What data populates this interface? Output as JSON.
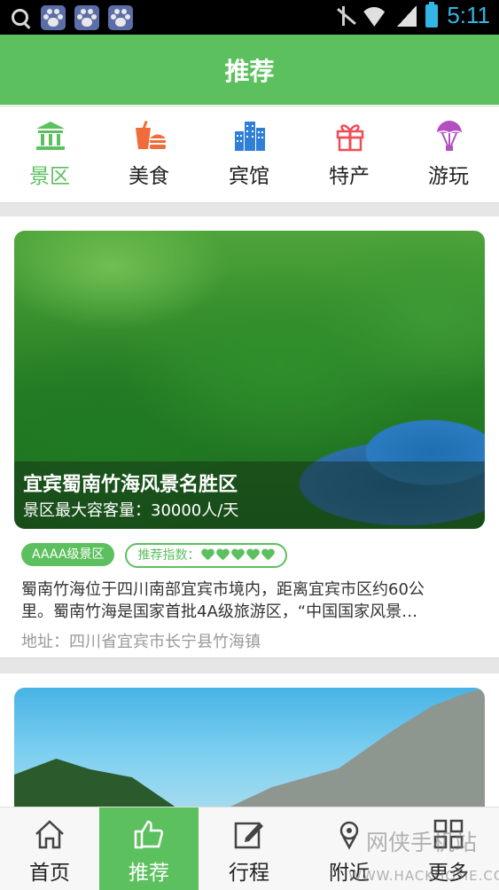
{
  "status_bar": {
    "time": "5:11"
  },
  "header": {
    "title": "推荐"
  },
  "categories": [
    {
      "label": "景区",
      "icon": "landmark-icon",
      "active": true
    },
    {
      "label": "美食",
      "icon": "food-icon",
      "active": false
    },
    {
      "label": "宾馆",
      "icon": "hotel-icon",
      "active": false
    },
    {
      "label": "特产",
      "icon": "gift-icon",
      "active": false
    },
    {
      "label": "游玩",
      "icon": "balloon-icon",
      "active": false
    }
  ],
  "card1": {
    "title": "宜宾蜀南竹海风景名胜区",
    "capacity": "景区最大容客量：30000人/天",
    "level_badge": "AAAA级景区",
    "rating_label": "推荐指数：",
    "rating": 5,
    "description_line1": "蜀南竹海位于四川南部宜宾市境内，距离宜宾市区约60公",
    "description_line2": "里。蜀南竹海是国家首批4A级旅游区，“中国国家风景…",
    "address": "地址：四川省宜宾市长宁县竹海镇"
  },
  "bottom_nav": [
    {
      "label": "首页",
      "icon": "home-icon",
      "active": false
    },
    {
      "label": "推荐",
      "icon": "thumbs-up-icon",
      "active": true
    },
    {
      "label": "行程",
      "icon": "edit-icon",
      "active": false
    },
    {
      "label": "附近",
      "icon": "location-icon",
      "active": false
    },
    {
      "label": "更多",
      "icon": "grid-icon",
      "active": false
    }
  ],
  "watermark": {
    "line1": "网侠手机站",
    "line2": "WWW.HACKHOME.COM"
  },
  "colors": {
    "brand_green": "#5cc05e",
    "status_blue": "#33b5e5"
  }
}
